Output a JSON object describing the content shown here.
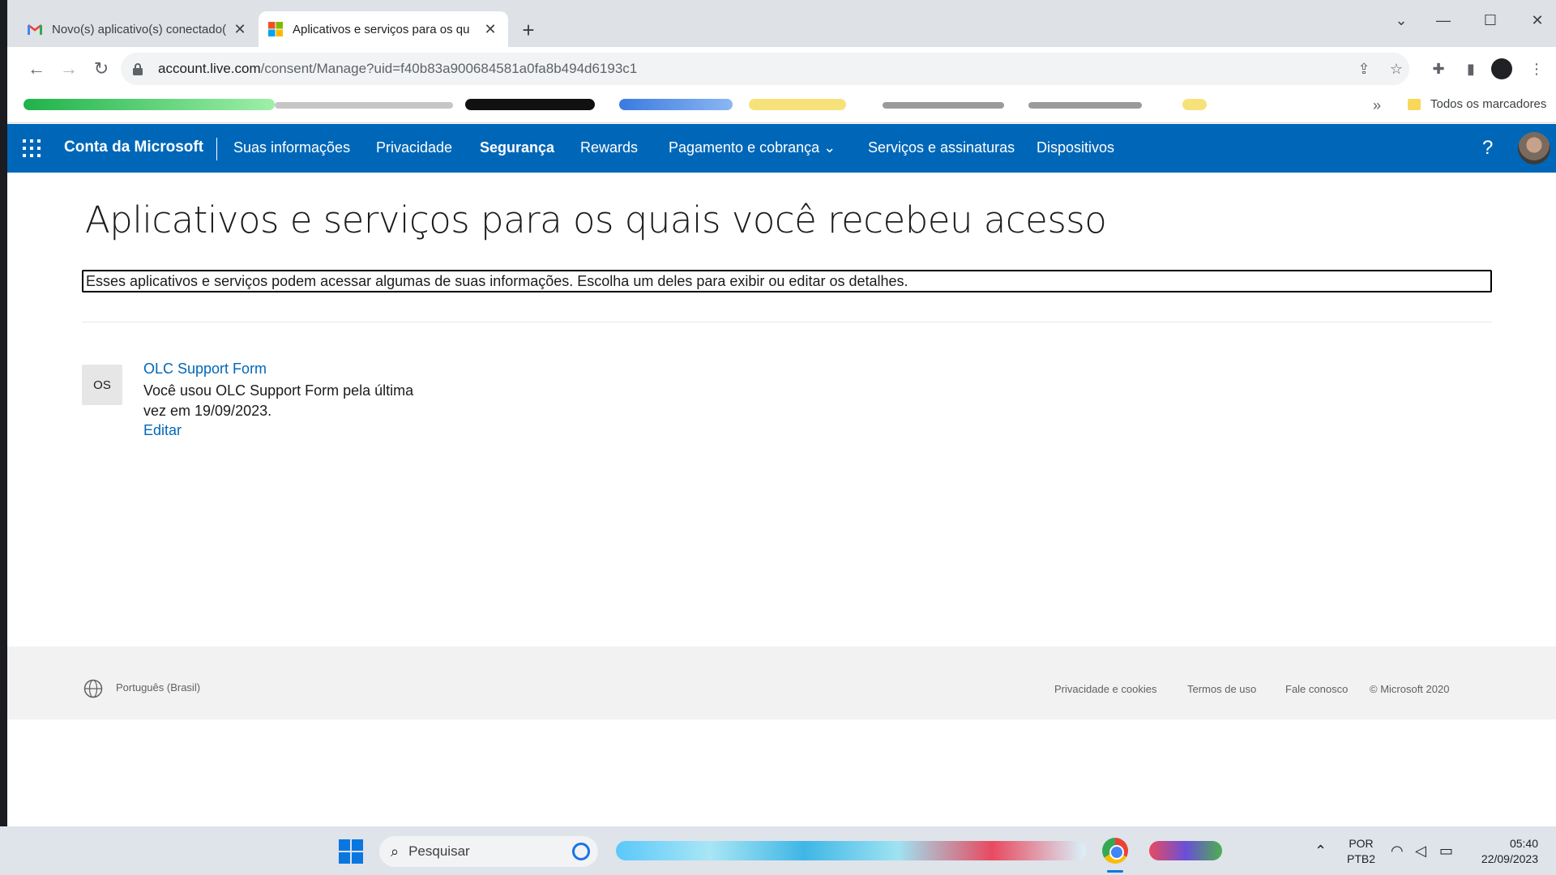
{
  "browser": {
    "tabs": [
      {
        "title": "Novo(s) aplicativo(s) conectado(",
        "active": false
      },
      {
        "title": "Aplicativos e serviços para os qu",
        "active": true
      }
    ],
    "url_host": "account.live.com",
    "url_path": "/consent/Manage?uid=f40b83a900684581a0fa8b494d6193c1",
    "bookmarks_more": "»",
    "bookmarks_folder": "Todos os marcadores"
  },
  "header": {
    "brand": "Conta da Microsoft",
    "nav": [
      {
        "label": "Suas informações"
      },
      {
        "label": "Privacidade"
      },
      {
        "label": "Segurança",
        "active": true
      },
      {
        "label": "Rewards"
      },
      {
        "label": "Pagamento e cobrança"
      },
      {
        "label": "Serviços e assinaturas"
      },
      {
        "label": "Dispositivos"
      }
    ],
    "help": "?",
    "accent_color": "#0067b8"
  },
  "page": {
    "title": "Aplicativos e serviços para os quais você recebeu acesso",
    "description": "Esses aplicativos e serviços podem acessar algumas de suas informações. Escolha um deles para exibir ou editar os detalhes.",
    "apps": [
      {
        "initials": "OS",
        "name": "OLC Support Form",
        "last_used": "Você usou OLC Support Form pela última vez em 19/09/2023.",
        "edit_label": "Editar"
      }
    ]
  },
  "footer": {
    "language": "Português (Brasil)",
    "links": [
      "Privacidade e cookies",
      "Termos de uso",
      "Fale conosco",
      "© Microsoft 2020"
    ]
  },
  "taskbar": {
    "search_placeholder": "Pesquisar",
    "lang_top": "POR",
    "lang_bottom": "PTB2",
    "time": "05:40",
    "date": "22/09/2023"
  }
}
